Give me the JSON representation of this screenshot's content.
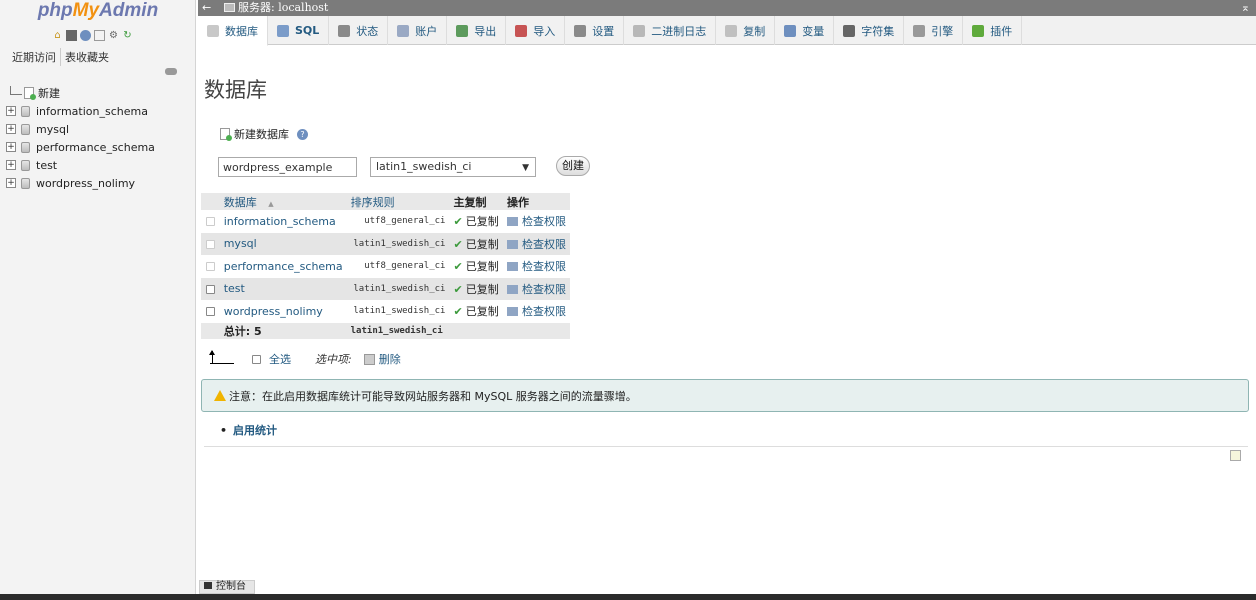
{
  "app": {
    "logo_php": "php",
    "logo_my": "My",
    "logo_admin": "Admin",
    "brand_color": "#6c78af",
    "accent_color": "#f29111"
  },
  "nav": {
    "tabs": [
      "近期访问",
      "表收藏夹"
    ],
    "tree": {
      "new_label": "新建",
      "databases": [
        "information_schema",
        "mysql",
        "performance_schema",
        "test",
        "wordpress_nolimy"
      ]
    }
  },
  "topbar": {
    "back": "←",
    "server": "服务器: localhost",
    "collapse": "⌅"
  },
  "menu": {
    "tabs": [
      {
        "label": "数据库",
        "icon": "database-icon"
      },
      {
        "label": "SQL",
        "icon": "sql-icon"
      },
      {
        "label": "状态",
        "icon": "status-icon"
      },
      {
        "label": "账户",
        "icon": "accounts-icon"
      },
      {
        "label": "导出",
        "icon": "export-icon"
      },
      {
        "label": "导入",
        "icon": "import-icon"
      },
      {
        "label": "设置",
        "icon": "settings-icon"
      },
      {
        "label": "二进制日志",
        "icon": "binlog-icon"
      },
      {
        "label": "复制",
        "icon": "replication-icon"
      },
      {
        "label": "变量",
        "icon": "variables-icon"
      },
      {
        "label": "字符集",
        "icon": "charset-icon"
      },
      {
        "label": "引擎",
        "icon": "engine-icon"
      },
      {
        "label": "插件",
        "icon": "plugin-icon"
      }
    ]
  },
  "main": {
    "title": "数据库",
    "create": {
      "heading": "新建数据库",
      "help": "?",
      "name_value": "wordpress_example",
      "collation_value": "latin1_swedish_ci",
      "button": "创建"
    },
    "table": {
      "headers": {
        "database": "数据库",
        "sort": "▲",
        "collation": "排序规则",
        "master_replication": "主复制",
        "action": "操作"
      },
      "rows": [
        {
          "name": "information_schema",
          "collation": "utf8_general_ci",
          "replication": "已复制",
          "action": "检查权限"
        },
        {
          "name": "mysql",
          "collation": "latin1_swedish_ci",
          "replication": "已复制",
          "action": "检查权限"
        },
        {
          "name": "performance_schema",
          "collation": "utf8_general_ci",
          "replication": "已复制",
          "action": "检查权限"
        },
        {
          "name": "test",
          "collation": "latin1_swedish_ci",
          "replication": "已复制",
          "action": "检查权限"
        },
        {
          "name": "wordpress_nolimy",
          "collation": "latin1_swedish_ci",
          "replication": "已复制",
          "action": "检查权限"
        }
      ],
      "total_label": "总计: 5",
      "total_collation": "latin1_swedish_ci"
    },
    "bulk": {
      "select_all": "全选",
      "with_selected": "选中项:",
      "delete": "删除"
    },
    "notice": "注意：在此启用数据库统计可能导致网站服务器和 MySQL 服务器之间的流量骤增。",
    "enable_stats": "启用统计"
  },
  "console": {
    "label": "控制台"
  }
}
